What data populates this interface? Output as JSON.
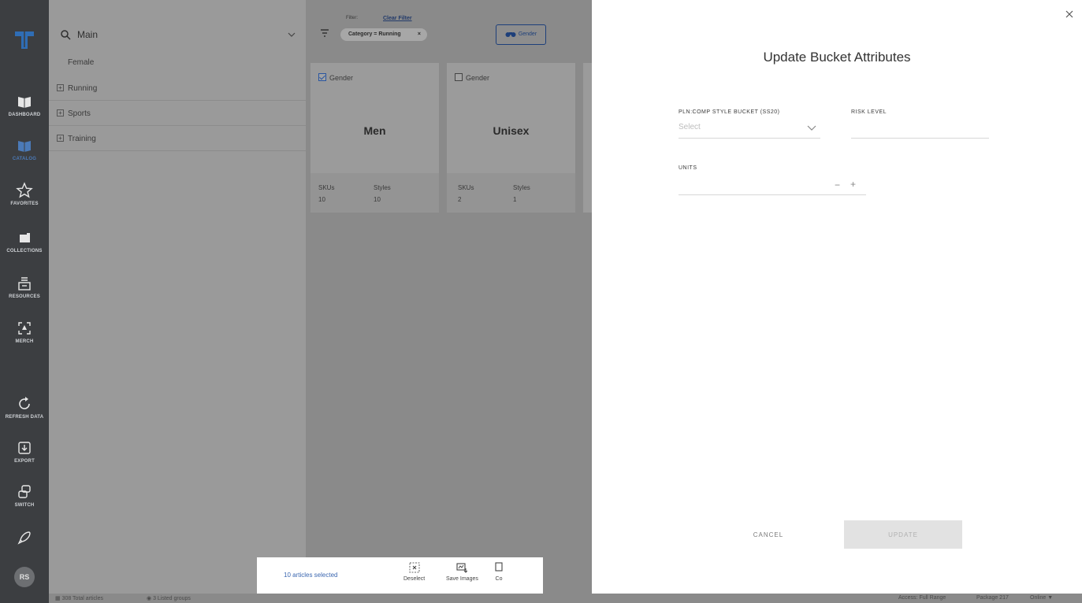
{
  "nav": {
    "items": [
      {
        "label": "DASHBOARD",
        "icon": "dashboard-icon"
      },
      {
        "label": "CATALOG",
        "icon": "catalog-icon"
      },
      {
        "label": "FAVORITES",
        "icon": "star-icon"
      },
      {
        "label": "COLLECTIONS",
        "icon": "folder-icon"
      },
      {
        "label": "RESOURCES",
        "icon": "resources-icon"
      },
      {
        "label": "MERCH",
        "icon": "merch-icon"
      },
      {
        "label": "REFRESH DATA",
        "icon": "refresh-icon"
      },
      {
        "label": "EXPORT",
        "icon": "export-icon"
      },
      {
        "label": "SWITCH",
        "icon": "switch-icon"
      }
    ],
    "avatar": "RS",
    "active_color": "#4b7ab8"
  },
  "tree": {
    "search_value": "Main",
    "group": "Female",
    "rows": [
      "Running",
      "Sports",
      "Training"
    ]
  },
  "toolbar": {
    "filter_label": "Filter:",
    "clear_filter": "Clear Filter",
    "chip": "Category = Running",
    "chip_close": "×",
    "group_button": "Gender"
  },
  "cards": [
    {
      "header": "Gender",
      "checked": true,
      "value": "Men",
      "skus_label": "SKUs",
      "styles_label": "Styles",
      "skus": "10",
      "styles": "10"
    },
    {
      "header": "Gender",
      "checked": false,
      "value": "Unisex",
      "skus_label": "SKUs",
      "styles_label": "Styles",
      "skus": "2",
      "styles": "1"
    }
  ],
  "selection_bar": {
    "count": "10 articles selected",
    "actions": [
      "Deselect",
      "Save Images",
      "Co"
    ]
  },
  "status": {
    "total": "308 Total articles",
    "listed": "3 Listed groups",
    "access": "Access: Full Range",
    "package": "Package 217",
    "online": "Online"
  },
  "drawer": {
    "title": "Update Bucket Attributes",
    "bucket_label": "PLN:COMP STYLE BUCKET (SS20)",
    "bucket_placeholder": "Select",
    "risk_label": "RISK LEVEL",
    "units_label": "UNITS",
    "minus": "−",
    "plus": "+",
    "cancel": "CANCEL",
    "update": "UPDATE"
  }
}
